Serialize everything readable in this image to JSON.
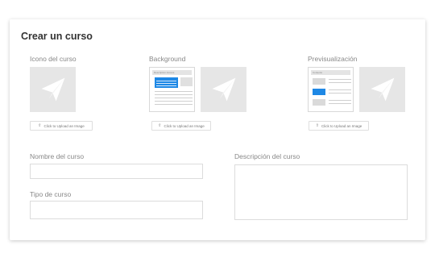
{
  "title": "Crear un curso",
  "icon_section": {
    "label": "Icono del curso",
    "upload_label": "Click to Upload an Image"
  },
  "background_section": {
    "label": "Background",
    "upload_label": "Click to Upload an Image",
    "mock_header": "Description Access"
  },
  "preview_section": {
    "label": "Previsualización",
    "upload_label": "Click to Upload an Image",
    "mock_header": "Contents"
  },
  "form": {
    "name_label": "Nombre del curso",
    "name_value": "",
    "type_label": "Tipo de curso",
    "type_value": "",
    "description_label": "Descripción del curso",
    "description_value": ""
  },
  "colors": {
    "accent": "#1e88e5",
    "placeholder": "#e6e6e6"
  },
  "icons": {
    "placeholder": "paper-plane-icon",
    "upload": "upload-icon"
  }
}
